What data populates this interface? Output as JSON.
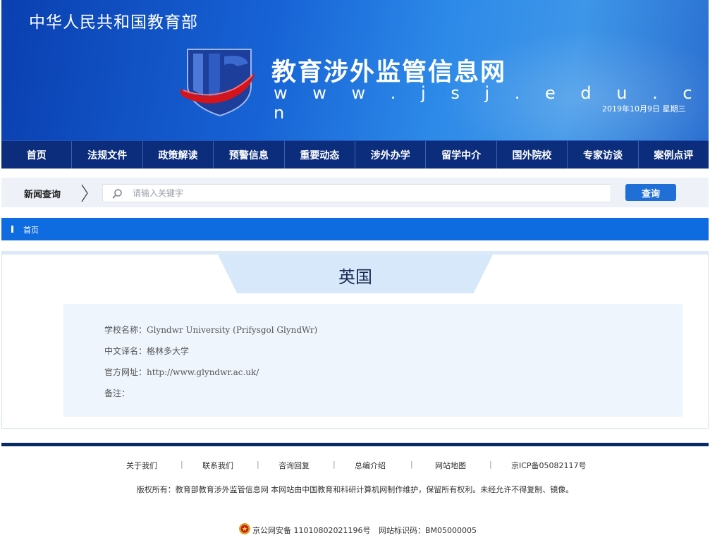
{
  "header": {
    "ministry": "中华人民共和国教育部",
    "site_title": "教育涉外监管信息网",
    "site_url": "w w w . j s j . e d u . c n",
    "date": "2019年10月9日  星期三"
  },
  "nav": [
    "首页",
    "法规文件",
    "政策解读",
    "预警信息",
    "重要动态",
    "涉外办学",
    "留学中介",
    "国外院校",
    "专家访谈",
    "案例点评"
  ],
  "search": {
    "label": "新闻查询",
    "placeholder": "请输入关键字",
    "button": "查询"
  },
  "breadcrumb": {
    "home": "首页"
  },
  "content": {
    "country": "英国",
    "rows": [
      "学校名称：Glyndwr University (Prifysgol GlyndWr)",
      "中文译名：格林多大学",
      "官方网址：http://www.glyndwr.ac.uk/",
      "备注："
    ]
  },
  "footer": {
    "links": [
      "关于我们",
      "联系我们",
      "咨询回复",
      "总编介绍",
      "网站地图",
      "京ICP备05082117号"
    ],
    "copyright": "版权所有：教育部教育涉外监管信息网 本网站由中国教育和科研计算机网制作维护，保留所有权利。未经允许不得复制、镜像。",
    "police_record": "京公网安备 11010802021196号",
    "site_code": "网站标识码：BM05000005"
  },
  "colors": {
    "nav_bg": "#0b2d7c",
    "breadcrumb_bg": "#0f6be0",
    "button_bg": "#1f6fd6",
    "footer_line": "#0a2a66"
  }
}
